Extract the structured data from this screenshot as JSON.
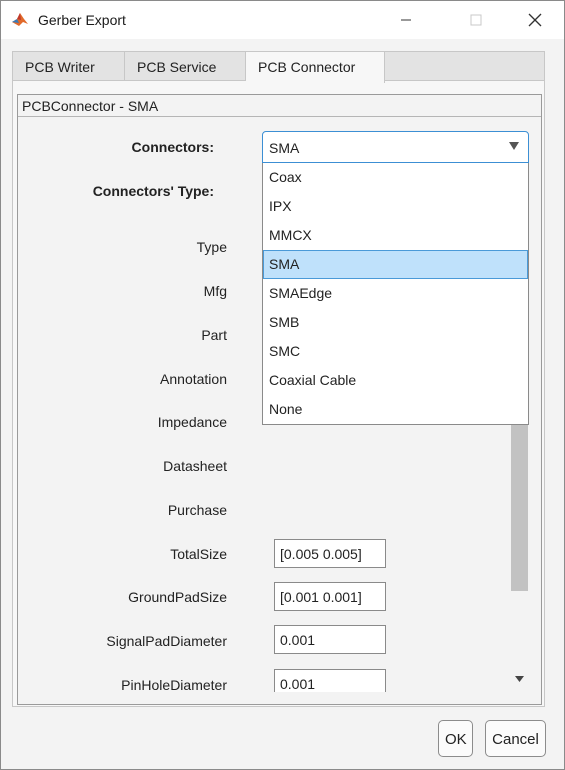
{
  "window": {
    "title": "Gerber Export",
    "controls": {
      "minimize": "minimize",
      "maximize": "maximize",
      "close": "close"
    }
  },
  "tabs": [
    {
      "label": "PCB Writer"
    },
    {
      "label": "PCB Service"
    },
    {
      "label": "PCB Connector"
    }
  ],
  "group": {
    "title": "PCBConnector - SMA"
  },
  "form": {
    "connectors_label": "Connectors:",
    "connectors_type_label": "Connectors' Type:",
    "type_label": "Type",
    "mfg_label": "Mfg",
    "part_label": "Part",
    "annotation_label": "Annotation",
    "impedance_label": "Impedance",
    "datasheet_label": "Datasheet",
    "purchase_label": "Purchase",
    "totalsize_label": "TotalSize",
    "totalsize_value": "[0.005 0.005]",
    "groundpadsize_label": "GroundPadSize",
    "groundpadsize_value": "[0.001 0.001]",
    "signalpaddiameter_label": "SignalPadDiameter",
    "signalpaddiameter_value": "0.001",
    "pinholediameter_label": "PinHoleDiameter",
    "pinholediameter_value": "0.001"
  },
  "dropdown": {
    "selected": "SMA",
    "options": [
      "Coax",
      "IPX",
      "MMCX",
      "SMA",
      "SMAEdge",
      "SMB",
      "SMC",
      "Coaxial Cable",
      "None"
    ]
  },
  "buttons": {
    "ok": "OK",
    "cancel": "Cancel"
  },
  "colors": {
    "accent": "#3c8fd4",
    "selection": "#bfe1fb"
  }
}
